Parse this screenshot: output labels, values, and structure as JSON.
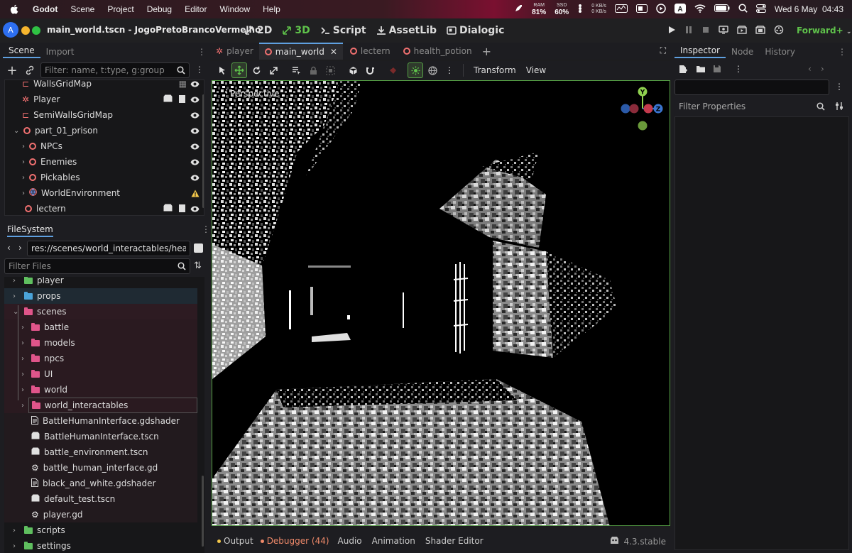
{
  "menubar": {
    "app": "Godot",
    "items": [
      "Scene",
      "Project",
      "Debug",
      "Editor",
      "Window",
      "Help"
    ],
    "ram_label": "RAM",
    "ram": "81%",
    "ssd_label": "SSD",
    "ssd": "60%",
    "net_up": "0 KB/s",
    "net_down": "0 KB/s",
    "clock": "Wed 6 May  04:43"
  },
  "titlebar": {
    "avatar": "A",
    "title": "main_world.tscn - JogoPretoBrancoVermelho",
    "modes": [
      "2D",
      "3D",
      "Script",
      "AssetLib",
      "Dialogic"
    ],
    "renderer": "Forward+"
  },
  "scene_dock": {
    "tabs": [
      "Scene",
      "Import"
    ],
    "filter_placeholder": "Filter: name, t:type, g:group",
    "nodes": [
      {
        "label": "WallsGridMap"
      },
      {
        "label": "Player"
      },
      {
        "label": "SemiWallsGridMap"
      },
      {
        "label": "part_01_prison"
      },
      {
        "label": "NPCs"
      },
      {
        "label": "Enemies"
      },
      {
        "label": "Pickables"
      },
      {
        "label": "WorldEnvironment"
      },
      {
        "label": "lectern"
      }
    ]
  },
  "filesystem": {
    "title": "FileSystem",
    "path": "res://scenes/world_interactables/health_p",
    "filter_placeholder": "Filter Files",
    "items": [
      {
        "label": "player"
      },
      {
        "label": "props"
      },
      {
        "label": "scenes"
      },
      {
        "label": "battle"
      },
      {
        "label": "models"
      },
      {
        "label": "npcs"
      },
      {
        "label": "UI"
      },
      {
        "label": "world"
      },
      {
        "label": "world_interactables"
      },
      {
        "label": "BattleHumanInterface.gdshader"
      },
      {
        "label": "BattleHumanInterface.tscn"
      },
      {
        "label": "battle_environment.tscn"
      },
      {
        "label": "battle_human_interface.gd"
      },
      {
        "label": "black_and_white.gdshader"
      },
      {
        "label": "default_test.tscn"
      },
      {
        "label": "player.gd"
      },
      {
        "label": "scripts"
      },
      {
        "label": "settings"
      }
    ]
  },
  "editor_tabs": [
    "player",
    "main_world",
    "lectern",
    "health_potion"
  ],
  "viewport_toolbar": {
    "transform": "Transform",
    "view": "View"
  },
  "viewport": {
    "perspective": "Perspective",
    "gizmo_y": "Y",
    "gizmo_z": "Z"
  },
  "bottom_bar": {
    "output": "Output",
    "debugger": "Debugger (44)",
    "audio": "Audio",
    "animation": "Animation",
    "shader_editor": "Shader Editor",
    "version": "4.3.stable"
  },
  "inspector": {
    "tabs": [
      "Inspector",
      "Node",
      "History"
    ],
    "filter_placeholder": "Filter Properties"
  },
  "colors": {
    "accent": "#56a146",
    "folder_blue": "#4aa3d8",
    "folder_pink": "#e0558a",
    "node_red": "#f07070",
    "warning": "#f5c84a"
  }
}
